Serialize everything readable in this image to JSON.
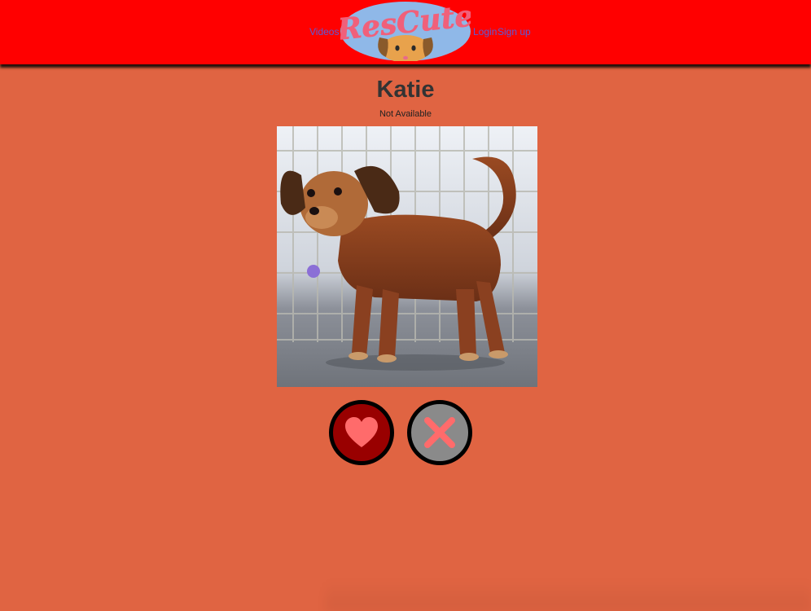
{
  "nav": {
    "videos_label": "Videos",
    "login_label": "Login",
    "signup_label": "Sign up",
    "logo_text": "ResCute"
  },
  "pet": {
    "name": "Katie",
    "status": "Not Available"
  },
  "actions": {
    "like_icon": "heart-icon",
    "dismiss_icon": "x-icon"
  },
  "colors": {
    "header_bg": "#ff0000",
    "page_bg": "#e06442",
    "link": "#5a5bd8",
    "like_button": "#990000",
    "dismiss_button": "#8a8a8a",
    "icon": "#ff6b6b"
  }
}
